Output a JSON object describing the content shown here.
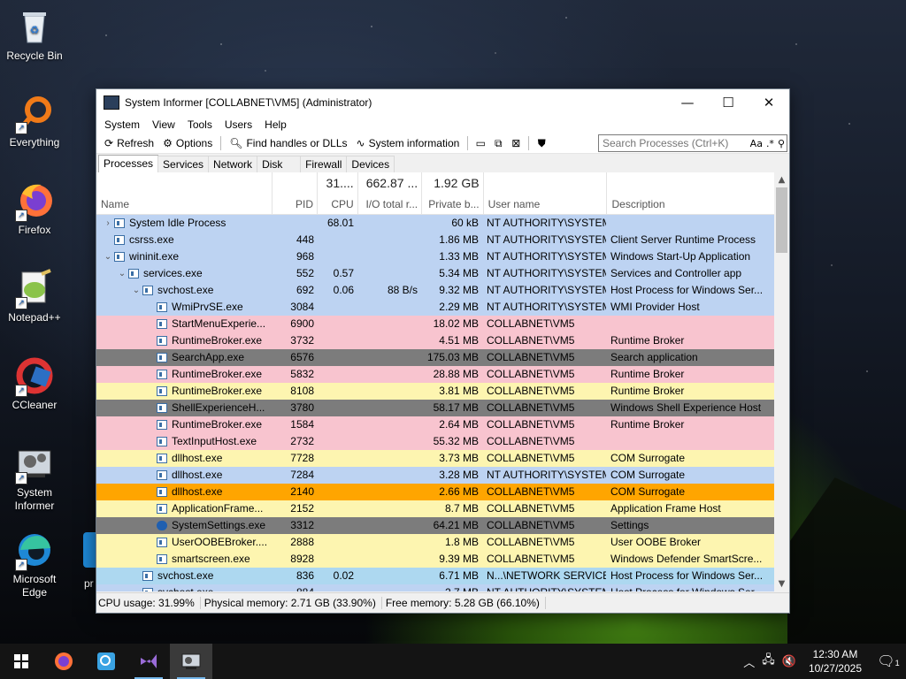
{
  "desktop": {
    "icons": [
      {
        "label": "Recycle Bin"
      },
      {
        "label": "Everything"
      },
      {
        "label": "Firefox"
      },
      {
        "label": "Notepad++"
      },
      {
        "label": "CCleaner"
      },
      {
        "label": "System Informer"
      },
      {
        "label": "Microsoft Edge"
      }
    ],
    "partial_label": "pr"
  },
  "window": {
    "title": "System Informer [COLLABNET\\VM5] (Administrator)",
    "controls": {
      "min": "—",
      "max": "☐",
      "close": "✕"
    },
    "menu": [
      "System",
      "View",
      "Tools",
      "Users",
      "Help"
    ],
    "toolbar": {
      "refresh": "Refresh",
      "options": "Options",
      "find": "Find handles or DLLs",
      "sysinfo": "System information",
      "search_placeholder": "Search Processes (Ctrl+K)",
      "search_aa": "Aa",
      "search_regex": ".*"
    },
    "tabs": [
      "Processes",
      "Services",
      "Network",
      "Disk",
      "Firewall",
      "Devices"
    ],
    "columns": {
      "name": "Name",
      "pid": "PID",
      "cpu": "CPU",
      "io": "I/O total r...",
      "private": "Private b...",
      "user": "User name",
      "desc": "Description",
      "cpu_total": "31....",
      "io_total": "662.87 ...",
      "private_total": "1.92 GB"
    },
    "rows": [
      {
        "indent": 0,
        "exp": "›",
        "name": "System Idle Process",
        "pid": "",
        "cpu": "68.01",
        "io": "",
        "priv": "60 kB",
        "user": "NT AUTHORITY\\SYSTEM",
        "desc": "",
        "bg": "#bdd3f2"
      },
      {
        "indent": 0,
        "exp": "",
        "name": "csrss.exe",
        "pid": "448",
        "cpu": "",
        "io": "",
        "priv": "1.86 MB",
        "user": "NT AUTHORITY\\SYSTEM",
        "desc": "Client Server Runtime Process",
        "bg": "#bdd3f2"
      },
      {
        "indent": 0,
        "exp": "⌄",
        "name": "wininit.exe",
        "pid": "968",
        "cpu": "",
        "io": "",
        "priv": "1.33 MB",
        "user": "NT AUTHORITY\\SYSTEM",
        "desc": "Windows Start-Up Application",
        "bg": "#bdd3f2"
      },
      {
        "indent": 1,
        "exp": "⌄",
        "name": "services.exe",
        "pid": "552",
        "cpu": "0.57",
        "io": "",
        "priv": "5.34 MB",
        "user": "NT AUTHORITY\\SYSTEM",
        "desc": "Services and Controller app",
        "bg": "#bdd3f2"
      },
      {
        "indent": 2,
        "exp": "⌄",
        "name": "svchost.exe",
        "pid": "692",
        "cpu": "0.06",
        "io": "88 B/s",
        "priv": "9.32 MB",
        "user": "NT AUTHORITY\\SYSTEM",
        "desc": "Host Process for Windows Ser...",
        "bg": "#bdd3f2"
      },
      {
        "indent": 3,
        "exp": "",
        "name": "WmiPrvSE.exe",
        "pid": "3084",
        "cpu": "",
        "io": "",
        "priv": "2.29 MB",
        "user": "NT AUTHORITY\\SYSTEM",
        "desc": "WMI Provider Host",
        "bg": "#bdd3f2"
      },
      {
        "indent": 3,
        "exp": "",
        "name": "StartMenuExperie...",
        "pid": "6900",
        "cpu": "",
        "io": "",
        "priv": "18.02 MB",
        "user": "COLLABNET\\VM5",
        "desc": "",
        "bg": "#f8c4cf"
      },
      {
        "indent": 3,
        "exp": "",
        "name": "RuntimeBroker.exe",
        "pid": "3732",
        "cpu": "",
        "io": "",
        "priv": "4.51 MB",
        "user": "COLLABNET\\VM5",
        "desc": "Runtime Broker",
        "bg": "#f8c4cf"
      },
      {
        "indent": 3,
        "exp": "",
        "name": "SearchApp.exe",
        "pid": "6576",
        "cpu": "",
        "io": "",
        "priv": "175.03 MB",
        "user": "COLLABNET\\VM5",
        "desc": "Search application",
        "bg": "#7c7c7c"
      },
      {
        "indent": 3,
        "exp": "",
        "name": "RuntimeBroker.exe",
        "pid": "5832",
        "cpu": "",
        "io": "",
        "priv": "28.88 MB",
        "user": "COLLABNET\\VM5",
        "desc": "Runtime Broker",
        "bg": "#f8c4cf"
      },
      {
        "indent": 3,
        "exp": "",
        "name": "RuntimeBroker.exe",
        "pid": "8108",
        "cpu": "",
        "io": "",
        "priv": "3.81 MB",
        "user": "COLLABNET\\VM5",
        "desc": "Runtime Broker",
        "bg": "#fdf5b0"
      },
      {
        "indent": 3,
        "exp": "",
        "name": "ShellExperienceH...",
        "pid": "3780",
        "cpu": "",
        "io": "",
        "priv": "58.17 MB",
        "user": "COLLABNET\\VM5",
        "desc": "Windows Shell Experience Host",
        "bg": "#7c7c7c"
      },
      {
        "indent": 3,
        "exp": "",
        "name": "RuntimeBroker.exe",
        "pid": "1584",
        "cpu": "",
        "io": "",
        "priv": "2.64 MB",
        "user": "COLLABNET\\VM5",
        "desc": "Runtime Broker",
        "bg": "#f8c4cf"
      },
      {
        "indent": 3,
        "exp": "",
        "name": "TextInputHost.exe",
        "pid": "2732",
        "cpu": "",
        "io": "",
        "priv": "55.32 MB",
        "user": "COLLABNET\\VM5",
        "desc": "",
        "bg": "#f8c4cf"
      },
      {
        "indent": 3,
        "exp": "",
        "name": "dllhost.exe",
        "pid": "7728",
        "cpu": "",
        "io": "",
        "priv": "3.73 MB",
        "user": "COLLABNET\\VM5",
        "desc": "COM Surrogate",
        "bg": "#fdf5b0"
      },
      {
        "indent": 3,
        "exp": "",
        "name": "dllhost.exe",
        "pid": "7284",
        "cpu": "",
        "io": "",
        "priv": "3.28 MB",
        "user": "NT AUTHORITY\\SYSTEM",
        "desc": "COM Surrogate",
        "bg": "#bdd3f2"
      },
      {
        "indent": 3,
        "exp": "",
        "name": "dllhost.exe",
        "pid": "2140",
        "cpu": "",
        "io": "",
        "priv": "2.66 MB",
        "user": "COLLABNET\\VM5",
        "desc": "COM Surrogate",
        "bg": "#ffa500"
      },
      {
        "indent": 3,
        "exp": "",
        "name": "ApplicationFrame...",
        "pid": "2152",
        "cpu": "",
        "io": "",
        "priv": "8.7 MB",
        "user": "COLLABNET\\VM5",
        "desc": "Application Frame Host",
        "bg": "#fdf5b0"
      },
      {
        "indent": 3,
        "exp": "",
        "name": "SystemSettings.exe",
        "pid": "3312",
        "cpu": "",
        "io": "",
        "priv": "64.21 MB",
        "user": "COLLABNET\\VM5",
        "desc": "Settings",
        "bg": "#7c7c7c",
        "gear": true
      },
      {
        "indent": 3,
        "exp": "",
        "name": "UserOOBEBroker....",
        "pid": "2888",
        "cpu": "",
        "io": "",
        "priv": "1.8 MB",
        "user": "COLLABNET\\VM5",
        "desc": "User OOBE Broker",
        "bg": "#fdf5b0"
      },
      {
        "indent": 3,
        "exp": "",
        "name": "smartscreen.exe",
        "pid": "8928",
        "cpu": "",
        "io": "",
        "priv": "9.39 MB",
        "user": "COLLABNET\\VM5",
        "desc": "Windows Defender SmartScre...",
        "bg": "#fdf5b0"
      },
      {
        "indent": 2,
        "exp": "",
        "name": "svchost.exe",
        "pid": "836",
        "cpu": "0.02",
        "io": "",
        "priv": "6.71 MB",
        "user": "N...\\NETWORK SERVICE",
        "desc": "Host Process for Windows Ser...",
        "bg": "#add8f0"
      },
      {
        "indent": 2,
        "exp": "",
        "name": "svchost.exe",
        "pid": "884",
        "cpu": "",
        "io": "",
        "priv": "2.7 MB",
        "user": "NT AUTHORITY\\SYSTEM",
        "desc": "Host Process for Windows Ser...",
        "bg": "#bdd3f2"
      }
    ],
    "status": {
      "cpu": "CPU usage: 31.99%",
      "phys": "Physical memory: 2.71 GB (33.90%)",
      "free": "Free memory: 5.28 GB (66.10%)"
    }
  },
  "taskbar": {
    "time": "12:30 AM",
    "date": "10/27/2025",
    "notif_count": "1"
  }
}
